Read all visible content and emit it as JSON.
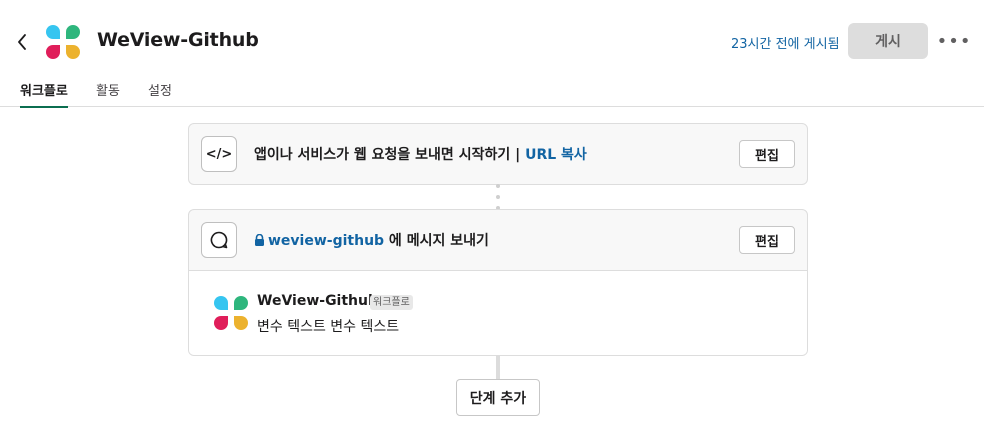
{
  "header": {
    "app_title": "WeView-Github",
    "published_status": "23시간 전에 게시됨",
    "publish_label": "게시",
    "more_label": "•••"
  },
  "tabs": [
    {
      "label": "워크플로",
      "active": true
    },
    {
      "label": "활동",
      "active": false
    },
    {
      "label": "설정",
      "active": false
    }
  ],
  "trigger_step": {
    "icon": "code-icon",
    "icon_text": "</>",
    "title": "앱이나 서비스가 웹 요청을 보내면 시작하기",
    "separator": " | ",
    "link_text": "URL 복사",
    "edit_label": "편집"
  },
  "message_step": {
    "icon": "message-bubble-icon",
    "channel": "weview-github",
    "title_suffix": " 에 메시지 보내기",
    "edit_label": "편집",
    "preview": {
      "sender": "WeView-Github",
      "badge": "워크플로",
      "text": "변수 텍스트 변수 텍스트"
    }
  },
  "add_step_label": "단계 추가",
  "colors": {
    "link": "#1264a3",
    "active_tab": "#0b6e50",
    "logo_blue": "#36c5f0",
    "logo_green": "#2eb67d",
    "logo_red": "#e01e5a",
    "logo_yellow": "#ecb22e"
  }
}
